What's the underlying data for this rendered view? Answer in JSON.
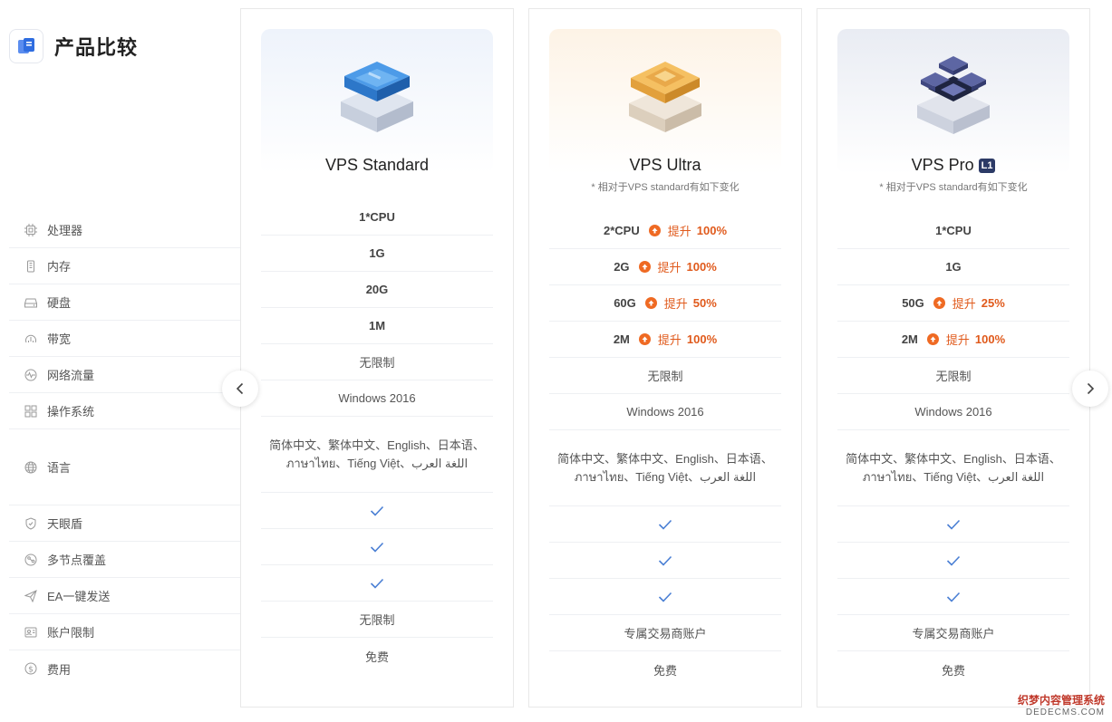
{
  "header": {
    "title": "产品比较"
  },
  "features": [
    {
      "label": "处理器",
      "icon": "cpu-icon"
    },
    {
      "label": "内存",
      "icon": "memory-icon"
    },
    {
      "label": "硬盘",
      "icon": "disk-icon"
    },
    {
      "label": "带宽",
      "icon": "gauge-icon"
    },
    {
      "label": "网络流量",
      "icon": "pulse-icon"
    },
    {
      "label": "操作系统",
      "icon": "grid-icon"
    },
    {
      "label": "语言",
      "icon": "globe-icon"
    },
    {
      "label": "天眼盾",
      "icon": "shield-icon"
    },
    {
      "label": "多节点覆盖",
      "icon": "nodes-icon"
    },
    {
      "label": "EA一键发送",
      "icon": "send-icon"
    },
    {
      "label": "账户限制",
      "icon": "account-icon"
    },
    {
      "label": "费用",
      "icon": "dollar-icon"
    }
  ],
  "plans": [
    {
      "name": "VPS Standard",
      "badge": "",
      "note": "",
      "theme": "blue",
      "cpu": "1*CPU",
      "memory": "1G",
      "disk": "20G",
      "bandwidth": "1M",
      "traffic": "无限制",
      "os": "Windows 2016",
      "languages_line1": "简体中文、繁体中文、English、日本语、",
      "languages_line2": "ภาษาไทย、Tiếng Việt、اللغة العرب",
      "account_limit": "无限制",
      "fee": "免费"
    },
    {
      "name": "VPS Ultra",
      "badge": "",
      "note": "* 相对于VPS standard有如下变化",
      "theme": "gold",
      "cpu": "2*CPU",
      "cpu_up": "100%",
      "memory": "2G",
      "memory_up": "100%",
      "disk": "60G",
      "disk_up": "50%",
      "bandwidth": "2M",
      "bandwidth_up": "100%",
      "traffic": "无限制",
      "os": "Windows 2016",
      "languages_line1": "简体中文、繁体中文、English、日本语、",
      "languages_line2": "ภาษาไทย、Tiếng Việt、اللغة العرب",
      "account_limit": "专属交易商账户",
      "fee": "免费"
    },
    {
      "name": "VPS Pro",
      "badge": "L1",
      "note": "* 相对于VPS standard有如下变化",
      "theme": "navy",
      "cpu": "1*CPU",
      "memory": "1G",
      "disk": "50G",
      "disk_up": "25%",
      "bandwidth": "2M",
      "bandwidth_up": "100%",
      "traffic": "无限制",
      "os": "Windows 2016",
      "languages_line1": "简体中文、繁体中文、English、日本语、",
      "languages_line2": "ภาษาไทย、Tiếng Việt、اللغة العرب",
      "account_limit": "专属交易商账户",
      "fee": "免费"
    }
  ],
  "upgrade_label": "提升",
  "watermark": {
    "line1": "织梦内容管理系统",
    "line2": "DEDECMS.COM"
  },
  "colors": {
    "accent": "#ef6a23",
    "check": "#4a7fd4",
    "badge": "#2c3a66"
  }
}
